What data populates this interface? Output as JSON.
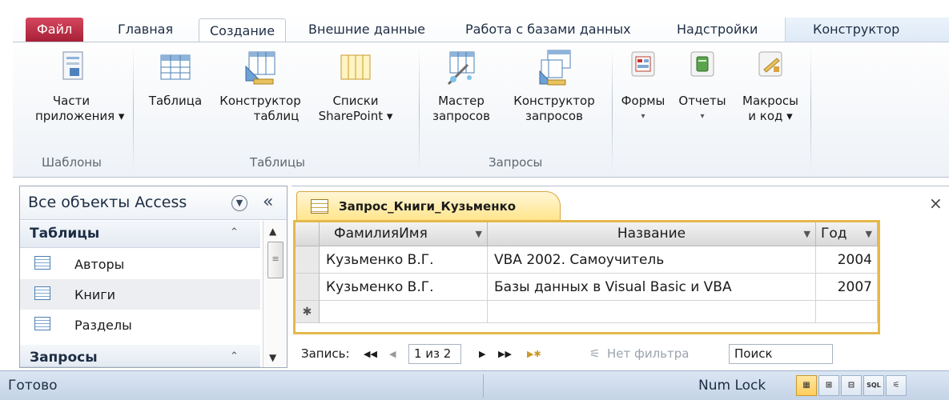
{
  "ribbon_tabs": [
    "Файл",
    "Главная",
    "Создание",
    "Внешние данные",
    "Работа с базами данных",
    "Надстройки",
    "Конструктор"
  ],
  "ribbon": {
    "app_parts": {
      "line1": "Части",
      "line2": "приложения ▾"
    },
    "table": {
      "line1": "Таблица"
    },
    "table_designer": {
      "line1": "Конструктор",
      "line2": "таблиц"
    },
    "sharepoint_lists": {
      "line1": "Списки",
      "line2": "SharePoint ▾"
    },
    "query_wizard": {
      "line1": "Мастер",
      "line2": "запросов"
    },
    "query_designer": {
      "line1": "Конструктор",
      "line2": "запросов"
    },
    "forms": {
      "line1": "Формы",
      "line2": "▾"
    },
    "reports": {
      "line1": "Отчеты",
      "line2": "▾"
    },
    "macros": {
      "line1": "Макросы",
      "line2": "и код ▾"
    },
    "groups": {
      "templates": "Шаблоны",
      "tables": "Таблицы",
      "queries": "Запросы"
    }
  },
  "nav": {
    "title": "Все объекты Access",
    "close": "«",
    "tables_header": "Таблицы",
    "tables": [
      "Авторы",
      "Книги",
      "Разделы"
    ],
    "queries_header": "Запросы",
    "collapse_glyph": "⌃"
  },
  "document": {
    "tab_title": "Запрос_Книги_Кузьменко",
    "close": "×",
    "columns": [
      "ФамилияИмя",
      "Название",
      "Год"
    ],
    "rows": [
      [
        "Кузьменко В.Г.",
        "VBA 2002. Самоучитель",
        "2004"
      ],
      [
        "Кузьменко В.Г.",
        "Базы данных в Visual Basic и  VBA",
        "2007"
      ]
    ],
    "new_row_marker": "✱"
  },
  "record_nav": {
    "label": "Запись:",
    "first": "◀◀",
    "prev": "◀",
    "current": "1 из 2",
    "next": "▶",
    "last": "▶▶",
    "new": "▶✱",
    "filter": "Нет фильтра",
    "search": "Поиск"
  },
  "status": {
    "ready": "Готово",
    "numlock": "Num Lock",
    "views": [
      "▦",
      "⊞",
      "⊟",
      "SQL",
      "⚟"
    ]
  },
  "colors": {
    "file_tab": "#b72a41",
    "query_tab": "#ffe58c",
    "grid_border": "#e5b84b",
    "status_bar": "#cfdcec"
  }
}
